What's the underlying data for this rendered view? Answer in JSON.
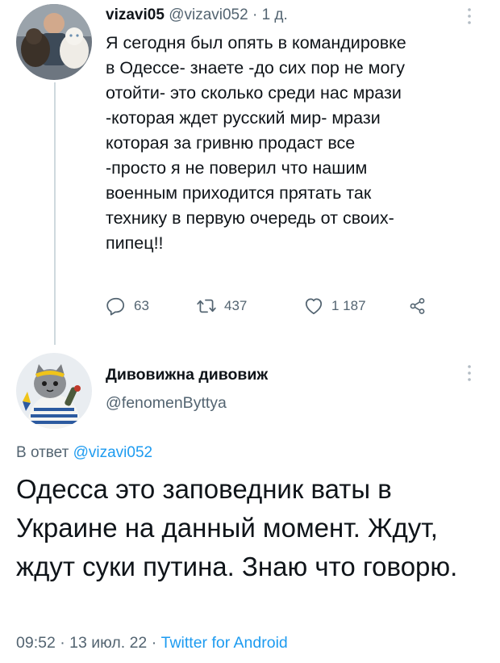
{
  "tweet": {
    "display_name": "vizavi05",
    "handle": "@vizavi052",
    "separator": "·",
    "time": "1 д.",
    "text": "Я сегодня был опять в командировке\nв Одессе- знаете -до сих пор не могу\nотойти- это сколько среди нас мрази\n-которая ждет русский мир- мрази\nкоторая за гривню продаст все\n-просто я не поверил что нашим\nвоенным приходится прятать так\nтехнику в первую очередь от своих-\nпипец!!",
    "actions": {
      "replies": "63",
      "retweets": "437",
      "likes": "1 187"
    }
  },
  "reply": {
    "display_name": "Дивовижна дивовиж",
    "handle": "@fenomenByttya",
    "replying_to_prefix": "В ответ",
    "replying_to_handle": "@vizavi052",
    "text": "Одесса это заповедник ваты в Украине на данный момент. Ждут, ждут суки путина. Знаю что говорю.",
    "time": "09:52",
    "date": "13 июл. 22",
    "separator_1": "·",
    "separator_2": "·",
    "source": "Twitter for Android"
  },
  "colors": {
    "text": "#0f1419",
    "secondary": "#536471",
    "accent": "#1d9bf0",
    "thread_line": "#cfd9de"
  },
  "icons": [
    "more-vertical-icon",
    "reply-icon",
    "retweet-icon",
    "like-icon",
    "share-icon"
  ]
}
